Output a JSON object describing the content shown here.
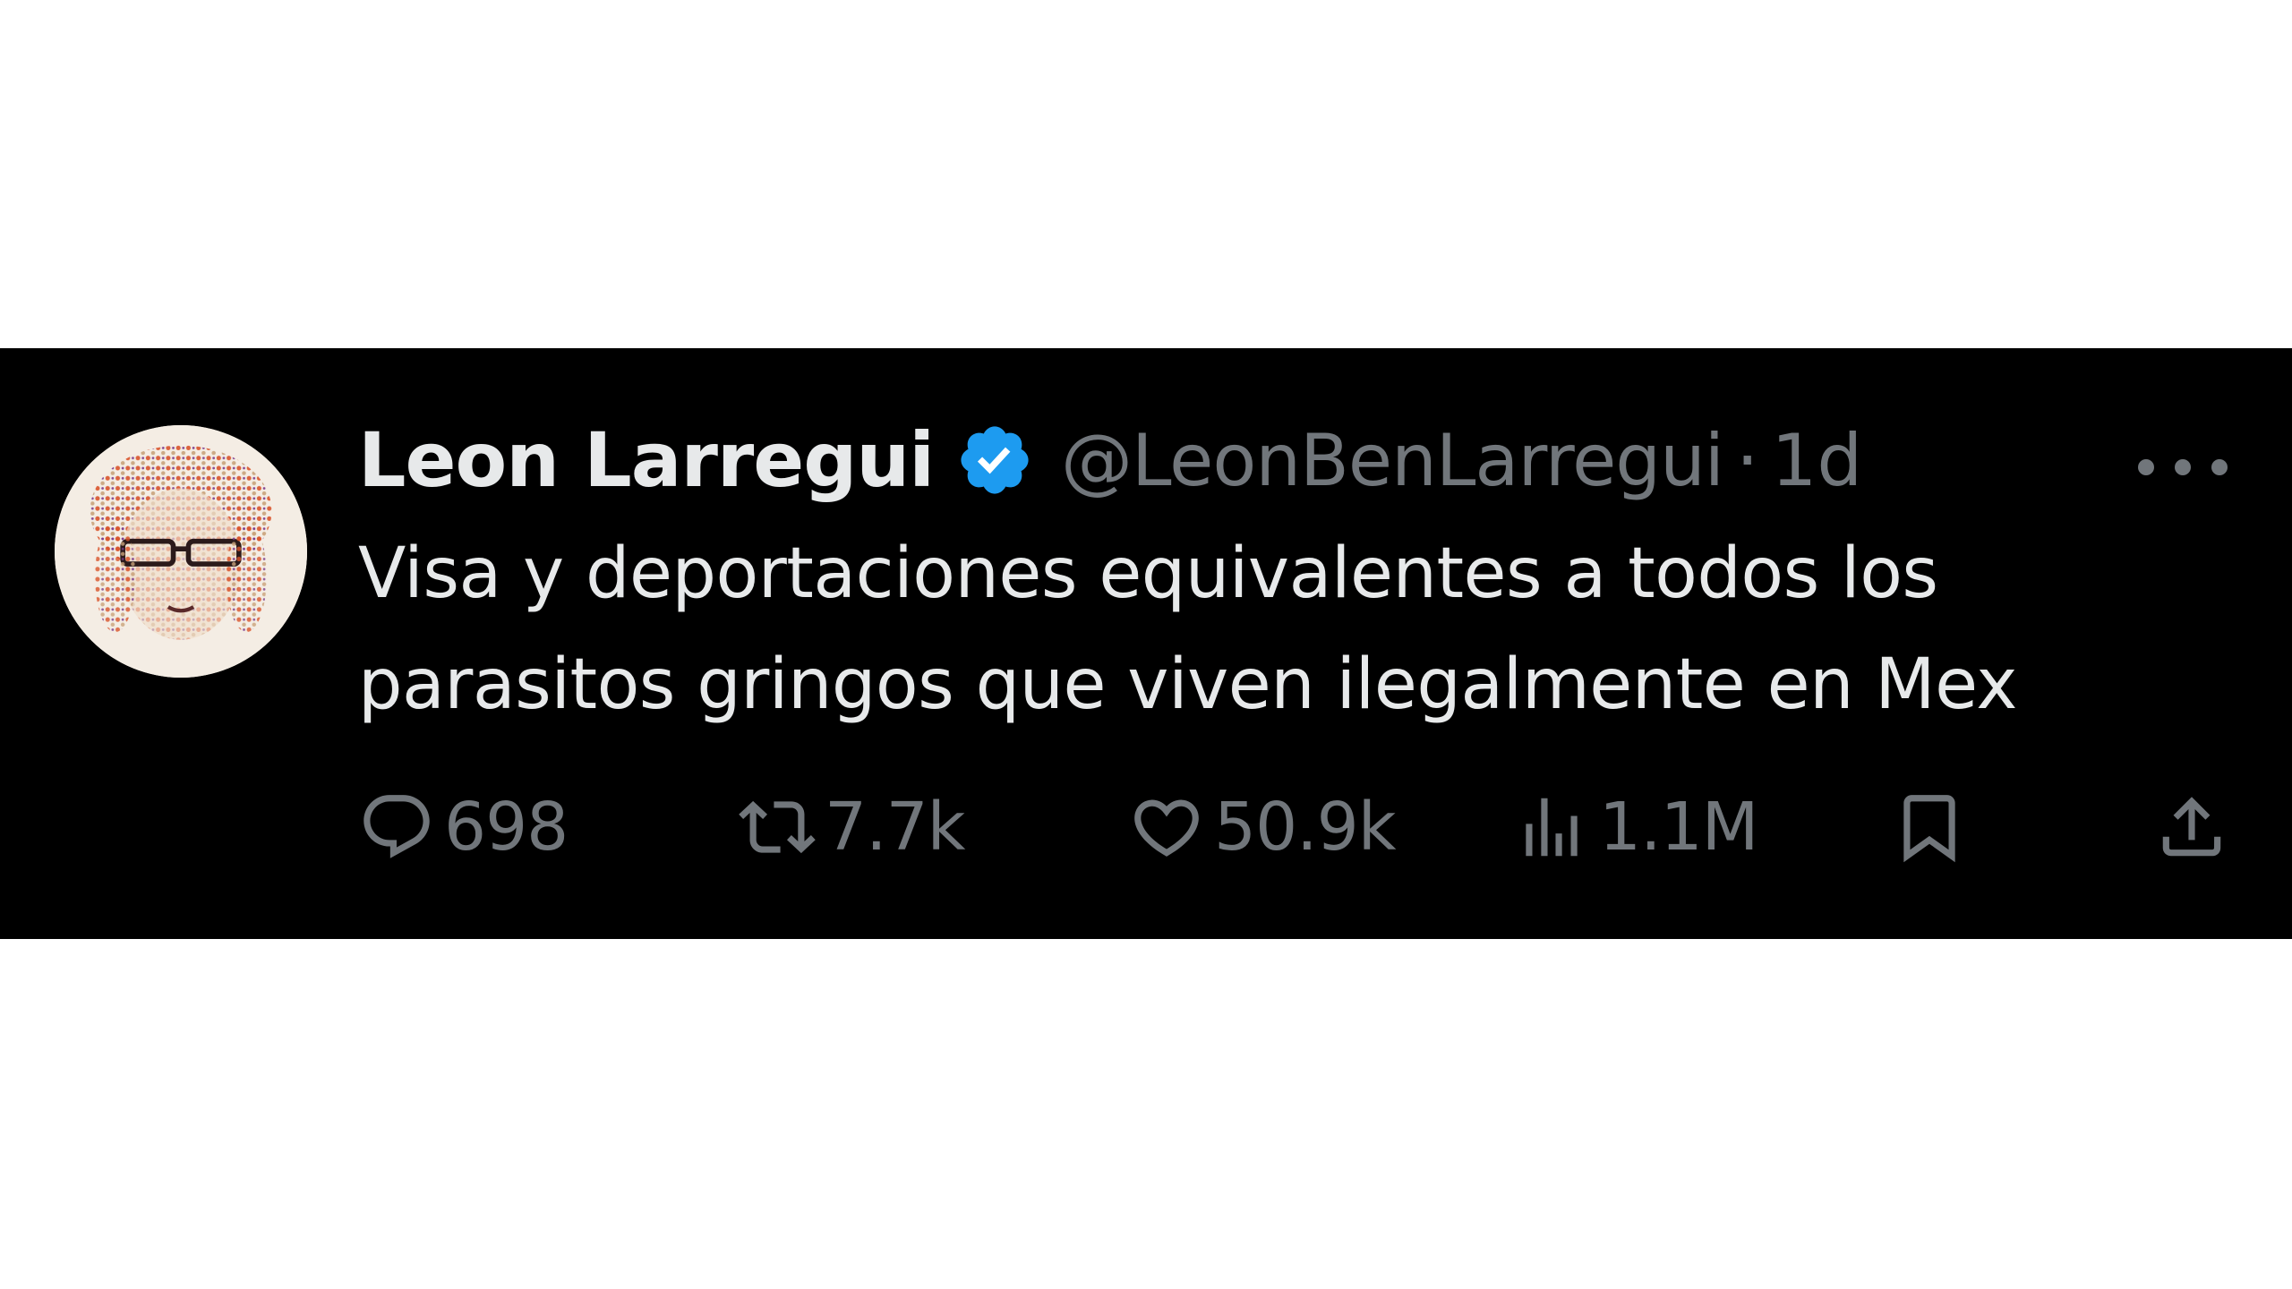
{
  "tweet": {
    "author": {
      "display_name": "Leon Larregui",
      "handle": "@LeonBenLarregui",
      "verified_icon": "verified-badge-icon",
      "verified_color": "#1d9bf0"
    },
    "separator": "·",
    "time": "1d",
    "text_lines": [
      "Visa y deportaciones equivalentes a todos los",
      "parasitos gringos que viven ilegalmente en Mex"
    ],
    "actions": {
      "replies": "698",
      "retweets": "7.7k",
      "likes": "50.9k",
      "views": "1.1M"
    }
  },
  "colors": {
    "background": "#000000",
    "primary_text": "#e7e9ea",
    "secondary_text": "#71767b"
  }
}
